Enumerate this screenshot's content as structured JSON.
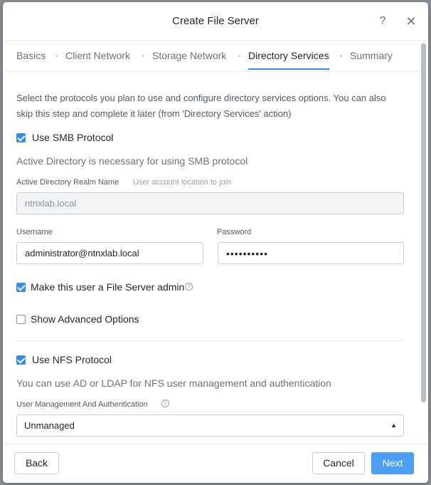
{
  "dialog": {
    "title": "Create File Server",
    "help_glyph": "?",
    "close_glyph": "✕"
  },
  "tabs": [
    {
      "label": "Basics",
      "active": false
    },
    {
      "label": "Client Network",
      "active": false
    },
    {
      "label": "Storage Network",
      "active": false
    },
    {
      "label": "Directory Services",
      "active": true
    },
    {
      "label": "Summary",
      "active": false
    }
  ],
  "content": {
    "intro": "Select the protocols you plan to use and configure directory services options. You can also skip this step and complete it later (from 'Directory Services' action)",
    "smb": {
      "checkbox_label": "Use SMB Protocol",
      "checked": true,
      "note": "Active Directory is necessary for using SMB protocol",
      "realm_label": "Active Directory Realm Name",
      "realm_hint": "User account location to join",
      "realm_value": "ntnxlab.local",
      "username_label": "Username",
      "username_value": "administrator@ntnxlab.local",
      "password_label": "Password",
      "password_value": "••••••••••",
      "admin_checkbox_label": "Make this user a File Server admin",
      "admin_checked": true,
      "advanced_checkbox_label": "Show Advanced Options",
      "advanced_checked": false
    },
    "nfs": {
      "checkbox_label": "Use NFS Protocol",
      "checked": true,
      "note": "You can use AD or LDAP for NFS user management and authentication",
      "auth_label": "User Management And Authentication",
      "auth_value": "Unmanaged",
      "chevron_glyph": "▲"
    },
    "info_glyph": "?"
  },
  "footer": {
    "back_label": "Back",
    "cancel_label": "Cancel",
    "next_label": "Next"
  },
  "colors": {
    "accent": "#2d8ff7",
    "primary_button": "#4a9ff5"
  }
}
